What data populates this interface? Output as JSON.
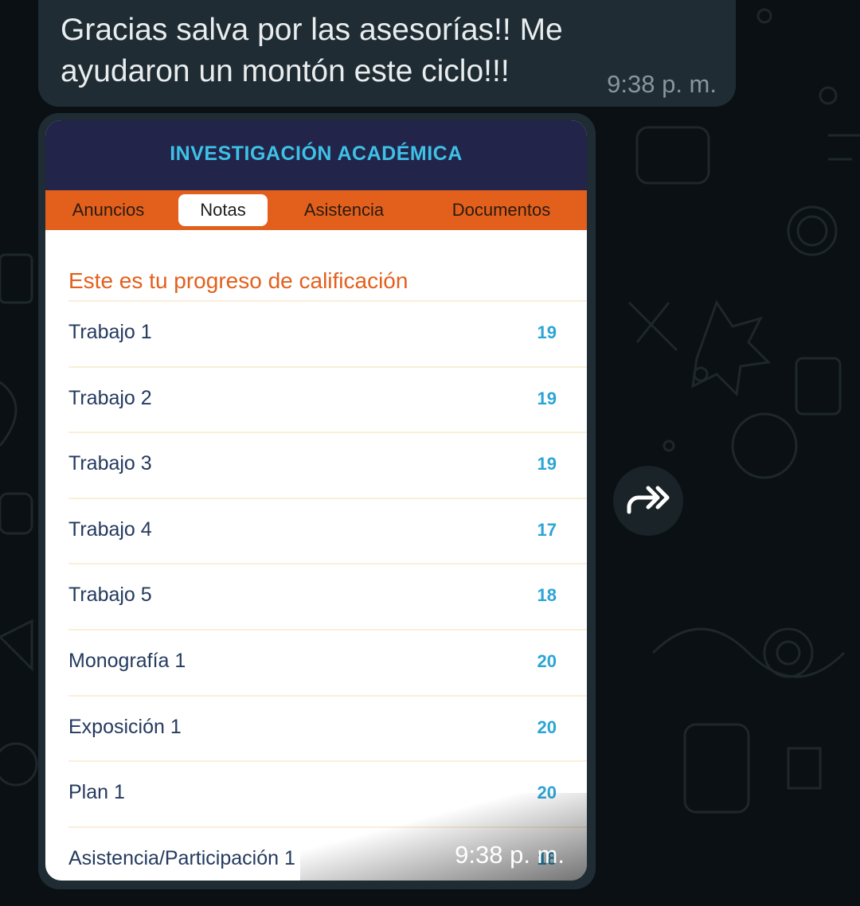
{
  "message": {
    "text": "Gracias salva por las asesorías!! Me ayudaron un montón este ciclo!!!",
    "time": "9:38 p. m."
  },
  "image_message": {
    "time": "9:38 p. m.",
    "app": {
      "title": "INVESTIGACIÓN ACADÉMICA",
      "tabs": [
        "Anuncios",
        "Notas",
        "Asistencia",
        "Documentos"
      ],
      "active_tab": "Notas",
      "section_title": "Este es tu progreso de calificación",
      "grades": [
        {
          "label": "Trabajo 1",
          "value": "19"
        },
        {
          "label": "Trabajo 2",
          "value": "19"
        },
        {
          "label": "Trabajo 3",
          "value": "19"
        },
        {
          "label": "Trabajo 4",
          "value": "17"
        },
        {
          "label": "Trabajo 5",
          "value": "18"
        },
        {
          "label": "Monografía 1",
          "value": "20"
        },
        {
          "label": "Exposición 1",
          "value": "20"
        },
        {
          "label": "Plan 1",
          "value": "20"
        },
        {
          "label": "Asistencia/Participación 1",
          "value": "18"
        }
      ]
    }
  },
  "colors": {
    "chat_background": "#0b1014",
    "bubble": "#1f2c33",
    "header": "#22244a",
    "accent_orange": "#e2601c",
    "grade_blue": "#2ba4d6"
  },
  "icons": [
    "forward-icon"
  ]
}
